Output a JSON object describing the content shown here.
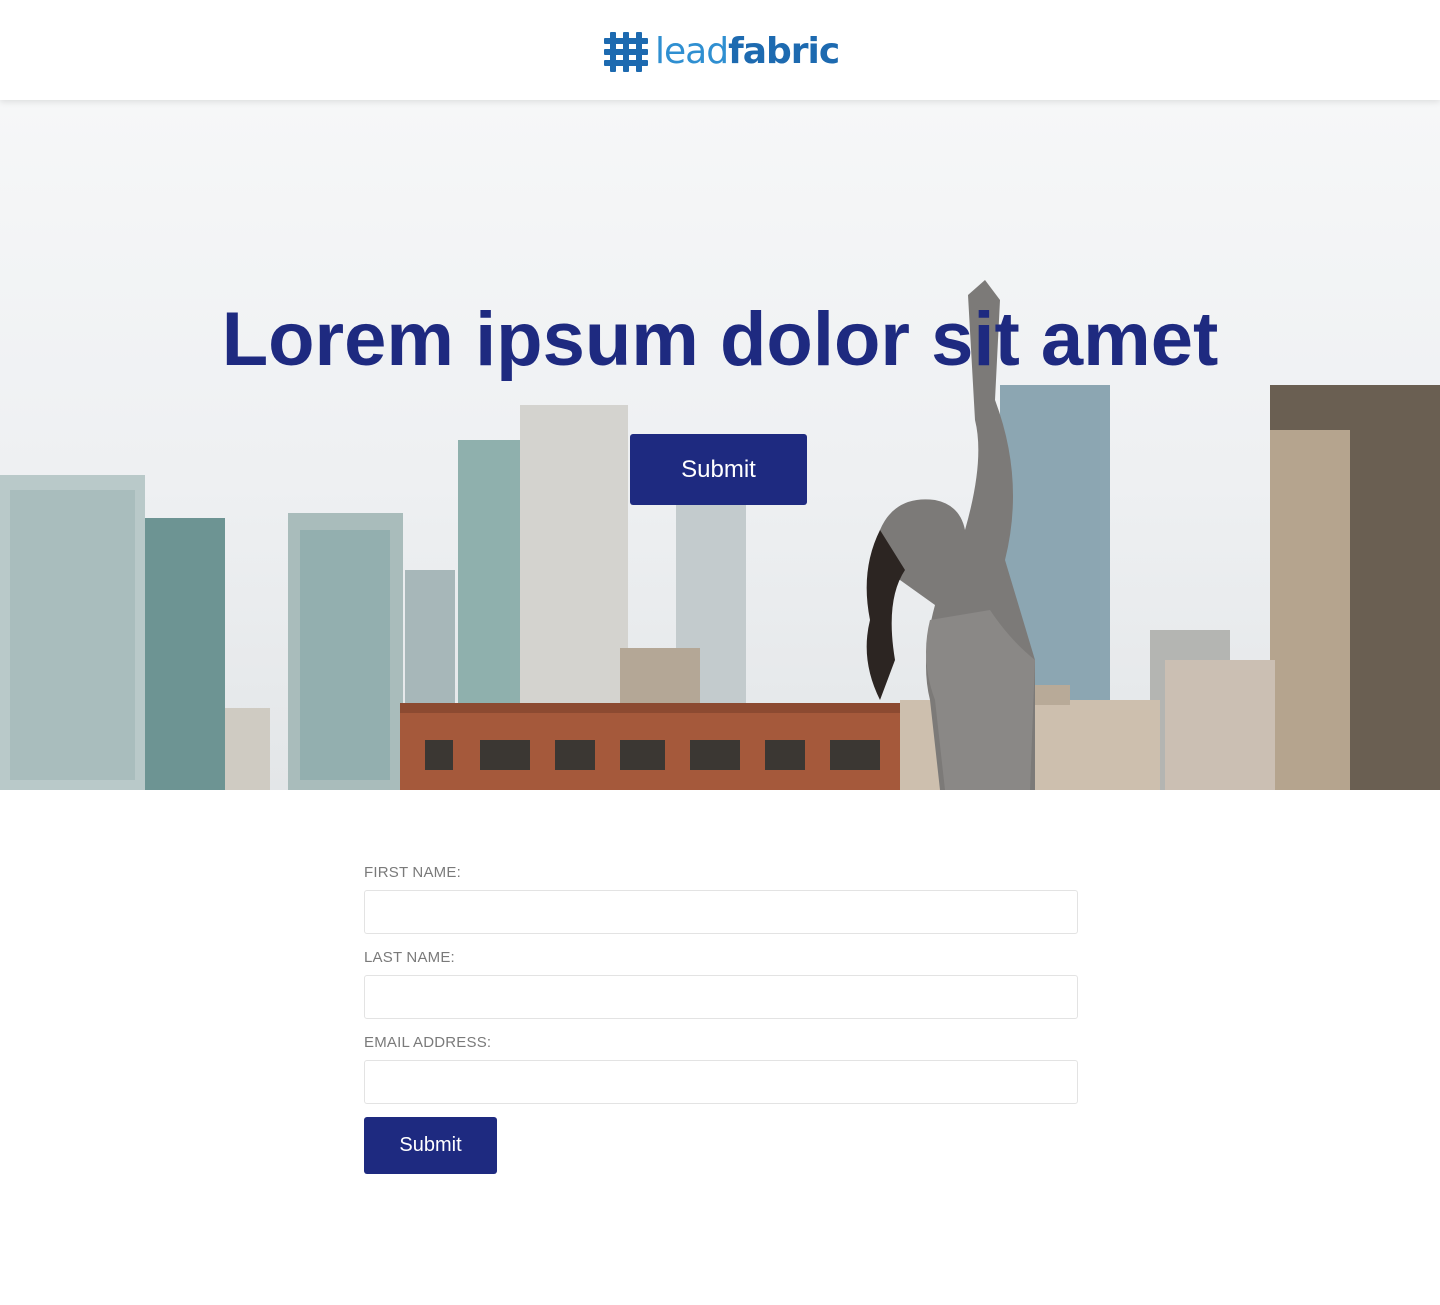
{
  "header": {
    "logo_lead": "lead",
    "logo_fabric": "fabric",
    "logo_colors": {
      "mark": "#1d6ab0",
      "lead": "#2f8fd1",
      "fabric": "#1d6ab0"
    }
  },
  "hero": {
    "title": "Lorem ipsum dolor sit amet",
    "button_label": "Submit",
    "colors": {
      "title": "#1e2a80",
      "button": "#1e2a80"
    }
  },
  "form": {
    "fields": [
      {
        "label": "FIRST NAME:",
        "value": "",
        "placeholder": ""
      },
      {
        "label": "LAST NAME:",
        "value": "",
        "placeholder": ""
      },
      {
        "label": "EMAIL ADDRESS:",
        "value": "",
        "placeholder": ""
      }
    ],
    "submit_label": "Submit"
  }
}
